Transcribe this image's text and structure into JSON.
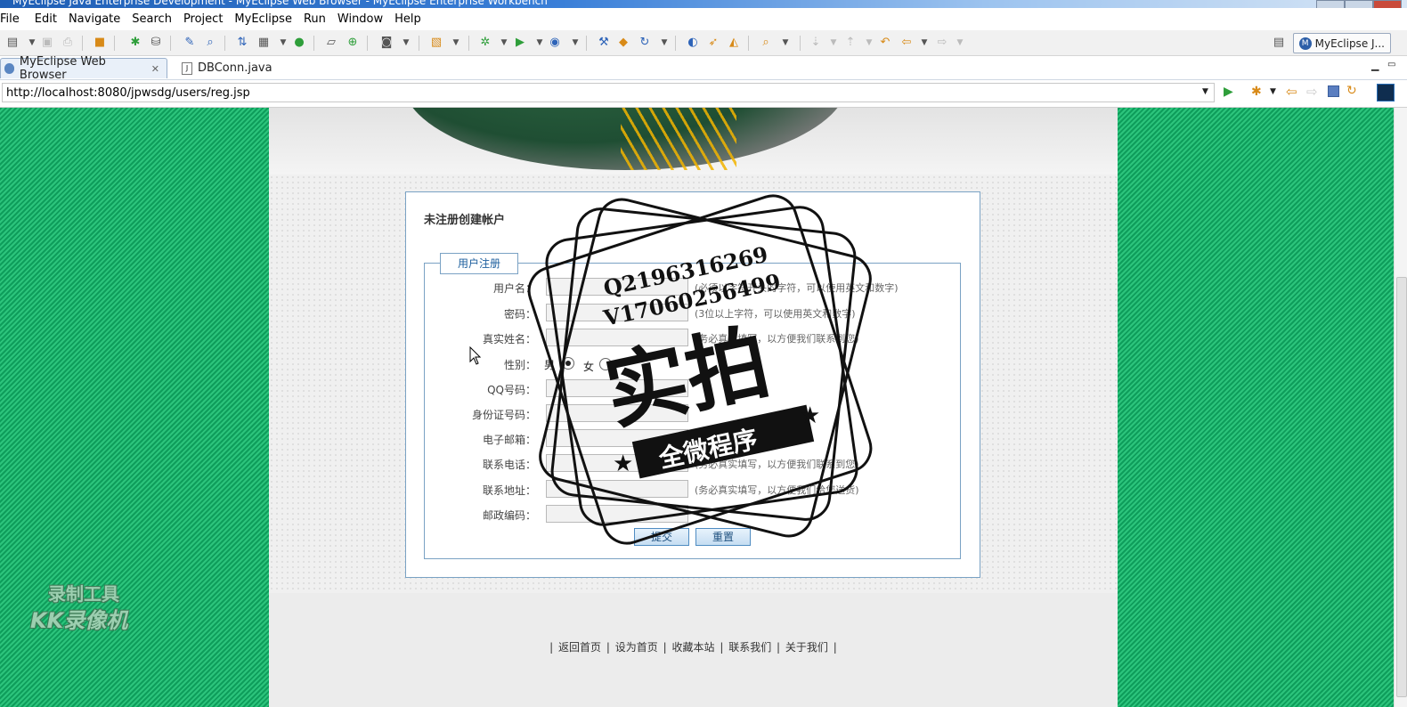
{
  "window": {
    "title": "MyEclipse Java Enterprise Development - MyEclipse Web Browser - MyEclipse Enterprise Workbench"
  },
  "menu": [
    "File",
    "Edit",
    "Navigate",
    "Search",
    "Project",
    "MyEclipse",
    "Run",
    "Window",
    "Help"
  ],
  "perspective": {
    "badge": "M",
    "label": "MyEclipse J..."
  },
  "tabs": [
    {
      "label": "MyEclipse Web Browser",
      "close": "✕"
    },
    {
      "label": "DBConn.java"
    }
  ],
  "browser": {
    "url": "http://localhost:8080/jpwsdg/users/reg.jsp"
  },
  "page": {
    "box_title": "未注册创建帐户",
    "legend": "用户注册",
    "fields": [
      {
        "label": "用户名：",
        "hint": "(必须以字符开头的字符，可以使用英文和数字)"
      },
      {
        "label": "密码：",
        "hint": "(3位以上字符，可以使用英文和数字)"
      },
      {
        "label": "真实姓名：",
        "hint": "(务必真实填写，以方便我们联系到您)"
      },
      {
        "label": "性别：",
        "hint": ""
      },
      {
        "label": "QQ号码：",
        "hint": ""
      },
      {
        "label": "身份证号码：",
        "hint": ""
      },
      {
        "label": "电子邮箱：",
        "hint": ""
      },
      {
        "label": "联系电话：",
        "hint": "(务必真实填写，以方便我们联系到您)"
      },
      {
        "label": "联系地址：",
        "hint": "(务必真实填写，以方便我们给您送货)"
      },
      {
        "label": "邮政编码：",
        "hint": ""
      }
    ],
    "gender": {
      "male": "男",
      "female": "女"
    },
    "submit": "提交",
    "reset": "重置",
    "footer_links": [
      "返回首页",
      "设为首页",
      "收藏本站",
      "联系我们",
      "关于我们"
    ],
    "footer_sep": "|"
  },
  "watermark": {
    "qq": "Q2196316269",
    "v": "V17060256499",
    "big": "实拍",
    "ribbon": "全微程序",
    "star": "★"
  },
  "recorder": {
    "line1": "录制工具",
    "line2": "KK录像机"
  },
  "colors": {
    "bg_green": "#0e9d5b",
    "accent_blue": "#7aa2c4",
    "link_blue": "#1d5f9e"
  }
}
